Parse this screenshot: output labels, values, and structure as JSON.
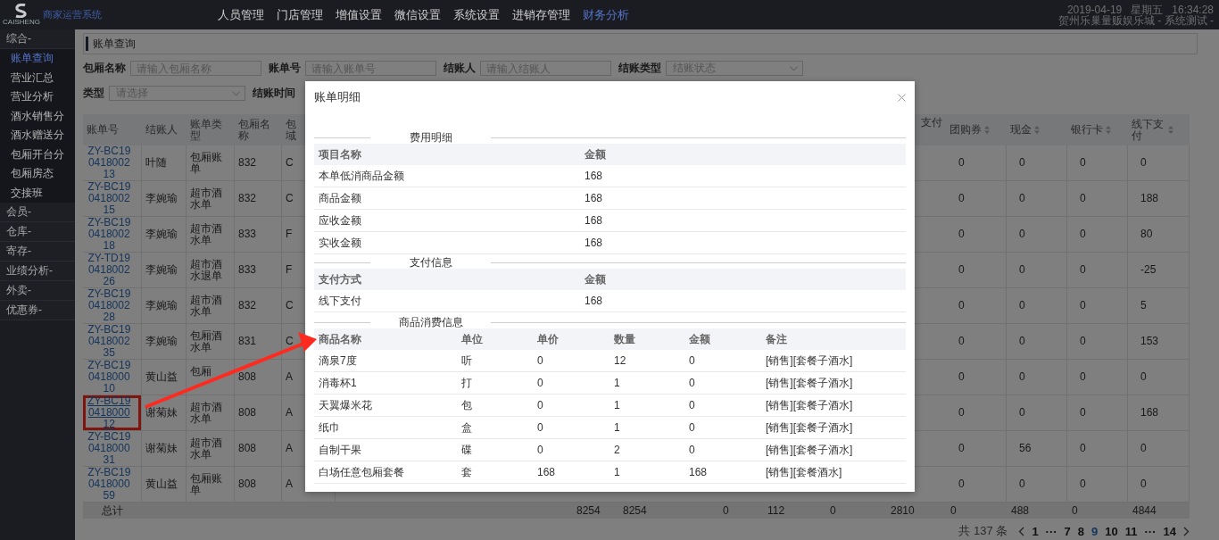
{
  "header": {
    "logo_text": "CAISHENG",
    "brand": "商家运营系统",
    "menu": [
      {
        "label": "人员管理",
        "selected": false
      },
      {
        "label": "门店管理",
        "selected": false
      },
      {
        "label": "增值设置",
        "selected": false
      },
      {
        "label": "微信设置",
        "selected": false
      },
      {
        "label": "系统设置",
        "selected": false
      },
      {
        "label": "进销存管理",
        "selected": false
      },
      {
        "label": "财务分析",
        "selected": true
      }
    ],
    "datetime": "2019-04-19   星期五   16:34:28",
    "store": "贺州乐巢量贩娱乐城 - 系统测试 -"
  },
  "sidebar": {
    "groups": [
      {
        "label": "综合-",
        "children": [
          {
            "label": "账单查询",
            "selected": true
          },
          {
            "label": "营业汇总",
            "selected": false
          },
          {
            "label": "营业分析",
            "selected": false
          },
          {
            "label": "酒水销售分",
            "selected": false
          },
          {
            "label": "酒水赠送分",
            "selected": false
          },
          {
            "label": "包厢开台分",
            "selected": false
          },
          {
            "label": "包厢房态",
            "selected": false
          },
          {
            "label": "交接班",
            "selected": false
          }
        ]
      },
      {
        "label": "会员-"
      },
      {
        "label": "仓库-"
      },
      {
        "label": "寄存-"
      },
      {
        "label": "业绩分析-"
      },
      {
        "label": "外卖-"
      },
      {
        "label": "优惠券-"
      }
    ]
  },
  "breadcrumb": "账单查询",
  "filters": [
    [
      {
        "label": "包厢名称",
        "kind": "input",
        "placeholder": "请输入包厢名称"
      },
      {
        "label": "账单号",
        "kind": "input",
        "placeholder": "请输入账单号"
      },
      {
        "label": "结账人",
        "kind": "input",
        "placeholder": "请输入结账人"
      },
      {
        "label": "结账类型",
        "kind": "select",
        "placeholder": "结账状态"
      }
    ],
    [
      {
        "label": "类型",
        "kind": "select",
        "placeholder": "请选择"
      },
      {
        "label": "结账时间",
        "kind": "label"
      }
    ]
  ],
  "table": {
    "left_columns": [
      {
        "label": "账单号",
        "sortable": false
      },
      {
        "label": "结账人",
        "sortable": false
      },
      {
        "label": "账单类型",
        "sortable": false
      },
      {
        "label": "包厢名称",
        "sortable": false
      },
      {
        "label": "包域",
        "sortable": false
      }
    ],
    "right_columns": [
      {
        "label": "支付",
        "sortable": false
      },
      {
        "label": "团购券",
        "sortable": true
      },
      {
        "label": "现金",
        "sortable": true
      },
      {
        "label": "银行卡",
        "sortable": true
      },
      {
        "label": "线下支付",
        "sortable": true
      }
    ],
    "rows": [
      {
        "bill_no": "ZY-BC19041800213",
        "cashier": "叶随",
        "bill_type": "包厢账单",
        "room_name": "832",
        "room_area": "C",
        "group_coupon": "0",
        "cash": "0",
        "bank_card": "0",
        "offline_payment": "0",
        "highlighted": false
      },
      {
        "bill_no": "ZY-BC19041800215",
        "cashier": "李婉瑜",
        "bill_type": "超市酒水单",
        "room_name": "832",
        "room_area": "C",
        "group_coupon": "0",
        "cash": "0",
        "bank_card": "0",
        "offline_payment": "188",
        "highlighted": false
      },
      {
        "bill_no": "ZY-BC19041800218",
        "cashier": "李婉瑜",
        "bill_type": "超市酒水单",
        "room_name": "833",
        "room_area": "F",
        "group_coupon": "0",
        "cash": "0",
        "bank_card": "0",
        "offline_payment": "80",
        "highlighted": false
      },
      {
        "bill_no": "ZY-TD19041800226",
        "cashier": "李婉瑜",
        "bill_type": "超市酒水退单",
        "room_name": "833",
        "room_area": "F",
        "group_coupon": "0",
        "cash": "0",
        "bank_card": "0",
        "offline_payment": "-25",
        "highlighted": false
      },
      {
        "bill_no": "ZY-BC19041800228",
        "cashier": "李婉瑜",
        "bill_type": "超市酒水单",
        "room_name": "832",
        "room_area": "C",
        "group_coupon": "0",
        "cash": "0",
        "bank_card": "0",
        "offline_payment": "5",
        "highlighted": false
      },
      {
        "bill_no": "ZY-BC19041800235",
        "cashier": "李婉瑜",
        "bill_type": "包厢酒水单",
        "room_name": "831",
        "room_area": "C",
        "group_coupon": "0",
        "cash": "0",
        "bank_card": "0",
        "offline_payment": "153",
        "highlighted": false
      },
      {
        "bill_no": "ZY-BC19041800010",
        "cashier": "黄山益",
        "bill_type": "包厢",
        "room_name": "808",
        "room_area": "A",
        "group_coupon": "0",
        "cash": "0",
        "bank_card": "0",
        "offline_payment": "0",
        "highlighted": false
      },
      {
        "bill_no": "ZY-BC19041800012",
        "cashier": "谢菊妹",
        "bill_type": "超市酒水单",
        "room_name": "808",
        "room_area": "A",
        "group_coupon": "0",
        "cash": "0",
        "bank_card": "0",
        "offline_payment": "168",
        "highlighted": true
      },
      {
        "bill_no": "ZY-BC19041800031",
        "cashier": "谢菊妹",
        "bill_type": "超市酒水单",
        "room_name": "808",
        "room_area": "A",
        "group_coupon": "0",
        "cash": "56",
        "bank_card": "0",
        "offline_payment": "0",
        "highlighted": false
      },
      {
        "bill_no": "ZY-BC19041800059",
        "cashier": "黄山益",
        "bill_type": "包厢账单",
        "room_name": "808",
        "room_area": "A",
        "group_coupon": "0",
        "cash": "0",
        "bank_card": "0",
        "offline_payment": "0",
        "highlighted": false
      }
    ],
    "totals": {
      "label": "总计",
      "column_10": "8254",
      "column_11": "8254",
      "column_13": "0",
      "column_14": "112",
      "column_15": "0",
      "column_16": "2810",
      "column_17": "0",
      "column_18": "488",
      "column_19": "0",
      "column_20": "4844"
    }
  },
  "pagination": {
    "total": "共 137 条",
    "pages": [
      {
        "label": "1",
        "kind": "page",
        "selected": false
      },
      {
        "label": "···",
        "kind": "ellipsis"
      },
      {
        "label": "7",
        "kind": "page",
        "selected": false
      },
      {
        "label": "8",
        "kind": "page",
        "selected": false
      },
      {
        "label": "9",
        "kind": "page",
        "selected": true
      },
      {
        "label": "10",
        "kind": "page",
        "selected": false
      },
      {
        "label": "11",
        "kind": "page",
        "selected": false
      },
      {
        "label": "···",
        "kind": "ellipsis"
      },
      {
        "label": "14",
        "kind": "page",
        "selected": false
      }
    ]
  },
  "modal": {
    "title": "账单明细",
    "sections": [
      {
        "title": "费用明细",
        "columns": [
          "项目名称",
          "金额"
        ],
        "rows": [
          [
            "本单低消商品金额",
            "168"
          ],
          [
            "商品金额",
            "168"
          ],
          [
            "应收金额",
            "168"
          ],
          [
            "实收金额",
            "168"
          ]
        ]
      },
      {
        "title": "支付信息",
        "columns": [
          "支付方式",
          "金额"
        ],
        "rows": [
          [
            "线下支付",
            "168"
          ]
        ]
      },
      {
        "title": "商品消费信息",
        "columns": [
          "商品名称",
          "单位",
          "单价",
          "数量",
          "金额",
          "备注"
        ],
        "rows": [
          [
            "滴泉7度",
            "听",
            "0",
            "12",
            "0",
            "[销售][套餐子酒水]"
          ],
          [
            "消毒杯1",
            "打",
            "0",
            "1",
            "0",
            "[销售][套餐子酒水]"
          ],
          [
            "天翼爆米花",
            "包",
            "0",
            "1",
            "0",
            "[销售][套餐子酒水]"
          ],
          [
            "纸巾",
            "盒",
            "0",
            "1",
            "0",
            "[销售][套餐子酒水]"
          ],
          [
            "自制干果",
            "碟",
            "0",
            "2",
            "0",
            "[销售][套餐子酒水]"
          ],
          [
            "白场任意包厢套餐",
            "套",
            "168",
            "1",
            "168",
            "[销售][套餐酒水]"
          ]
        ]
      }
    ]
  }
}
